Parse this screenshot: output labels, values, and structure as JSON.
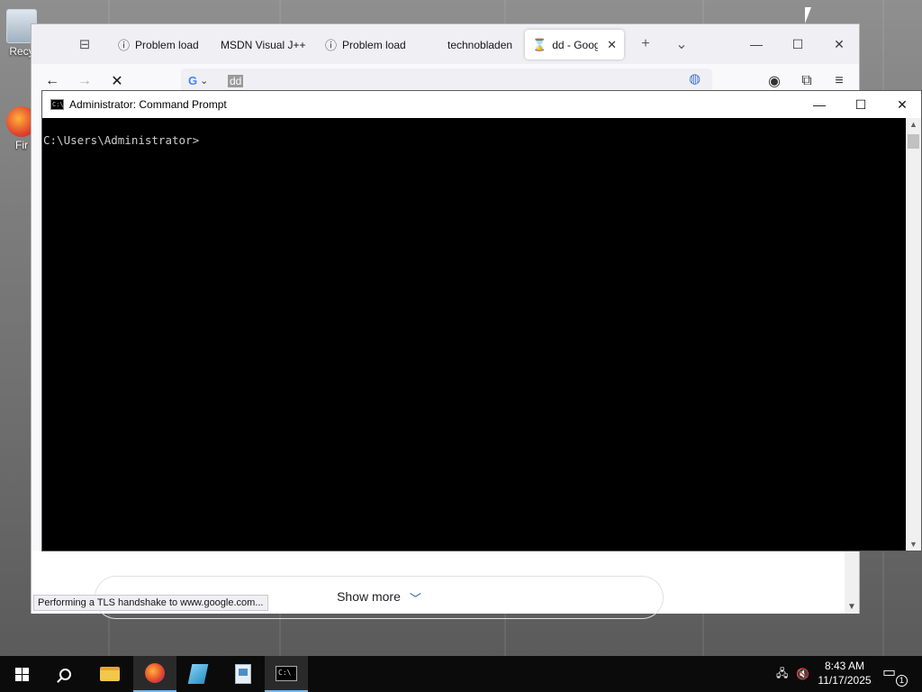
{
  "desktop": {
    "icons": [
      {
        "label": "Recy",
        "icon": "recycle-bin-icon"
      },
      {
        "label": "Fir",
        "icon": "firefox-shortcut-icon"
      }
    ]
  },
  "browser": {
    "tabs": [
      {
        "label": "Problem load",
        "icon": "info-icon",
        "active": false
      },
      {
        "label": "MSDN Visual J++",
        "icon": "",
        "active": false
      },
      {
        "label": "Problem load",
        "icon": "info-icon",
        "active": false
      },
      {
        "label": "technobladen",
        "icon": "",
        "active": false
      },
      {
        "label": "dd - Googl",
        "icon": "hourglass-icon",
        "active": true
      }
    ],
    "new_tab_symbol": "+",
    "list_tabs_symbol": "⌄",
    "url": {
      "engine": "G",
      "text": "dd"
    },
    "status_text": "Performing a TLS handshake to www.google.com...",
    "page": {
      "show_more_label": "Show more"
    }
  },
  "cmd": {
    "title": "Administrator: Command Prompt",
    "prompt": "C:\\Users\\Administrator>"
  },
  "taskbar": {
    "clock_time": "8:43 AM",
    "clock_date": "11/17/2025",
    "notification_count": "1"
  }
}
